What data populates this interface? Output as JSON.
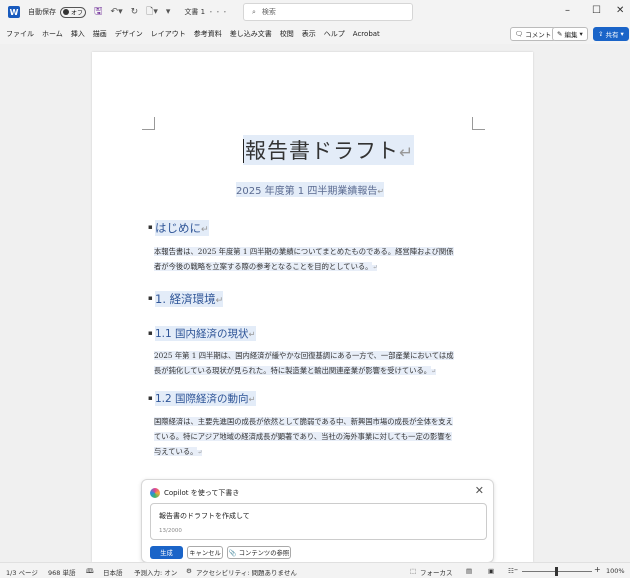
{
  "titlebar": {
    "autosave_label": "自動保存",
    "autosave_state": "オフ",
    "doc_title": "文書 1",
    "doc_title_suffix": "・・・",
    "search_placeholder": "検索"
  },
  "ribbon": {
    "tabs": [
      "ファイル",
      "ホーム",
      "挿入",
      "描画",
      "デザイン",
      "レイアウト",
      "参考資料",
      "差し込み文書",
      "校閲",
      "表示",
      "ヘルプ",
      "Acrobat"
    ],
    "comment_label": "コメント",
    "edit_label": "編集",
    "share_label": "共有"
  },
  "document": {
    "title": "報告書ドラフト",
    "subtitle": "2025 年度第 1 四半期業績報告",
    "sections": [
      {
        "heading": "はじめに",
        "body": [
          "本報告書は、2025 年度第 1 四半期の業績についてまとめたものである。経営陣および関係",
          "者が今後の戦略を立案する際の参考となることを目的としている。"
        ]
      },
      {
        "heading": "1. 経済環境"
      },
      {
        "heading": "1.1 国内経済の現状",
        "body": [
          "2025 年第 1 四半期は、国内経済が緩やかな回復基調にある一方で、一部産業においては成",
          "長が鈍化している現状が見られた。特に製造業と輸出関連産業が影響を受けている。"
        ]
      },
      {
        "heading": "1.2 国際経済の動向",
        "body": [
          "国際経済は、主要先進国の成長が依然として脆弱である中、新興国市場の成長が全体を支え",
          "ている。特にアジア地域の経済成長が顕著であり、当社の海外事業に対しても一定の影響を",
          "与えている。"
        ]
      }
    ]
  },
  "copilot": {
    "title": "Copilot を使って下書き",
    "prompt_text": "報告書のドラフトを作成して",
    "char_count": "13/2000",
    "generate_label": "生成",
    "cancel_label": "キャンセル",
    "reference_label": "コンテンツの参照"
  },
  "statusbar": {
    "page": "1/3 ページ",
    "words": "968 単語",
    "language": "日本語",
    "input": "予測入力: オン",
    "accessibility": "アクセシビリティ: 問題ありません",
    "focus": "フォーカス",
    "zoom": "100%"
  },
  "colors": {
    "accent": "#1a64c8",
    "heading": "#2f5597",
    "highlight": "#e3ecf8"
  }
}
